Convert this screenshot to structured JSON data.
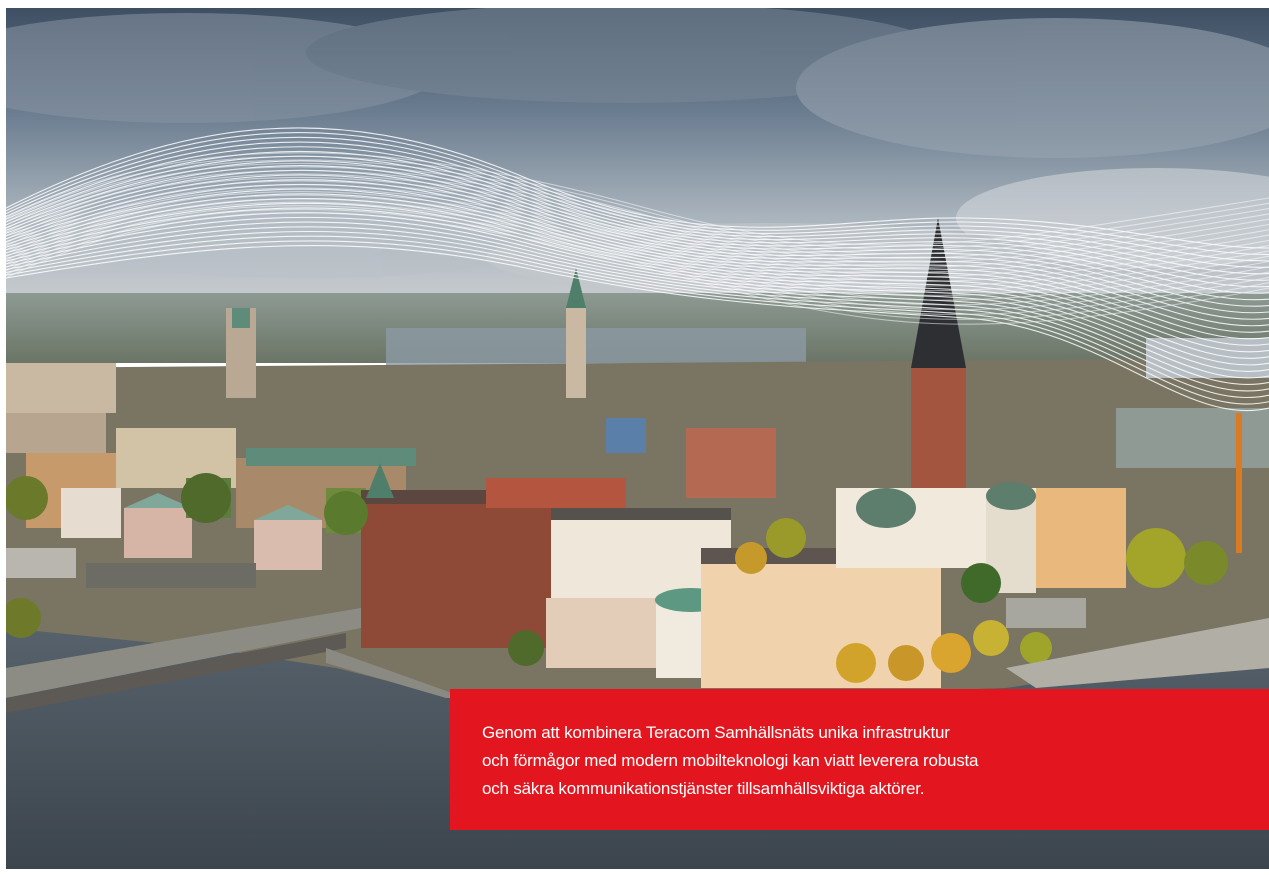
{
  "photo": {
    "subject": "aerial-city-with-signal-waves",
    "sky_color": "#5b6e82",
    "water_color": "#4a5560",
    "wave_color": "#ffffff"
  },
  "caption": {
    "text": "Genom att kombinera Teracom Samhällsnäts unika infrastruktur\noch förmågor med modern mobilteknologi kan viatt leverera robusta\noch säkra kommunikationstjänster tillsamhällsviktiga aktörer.",
    "background": "#e3161f",
    "text_color": "#ffffff"
  }
}
